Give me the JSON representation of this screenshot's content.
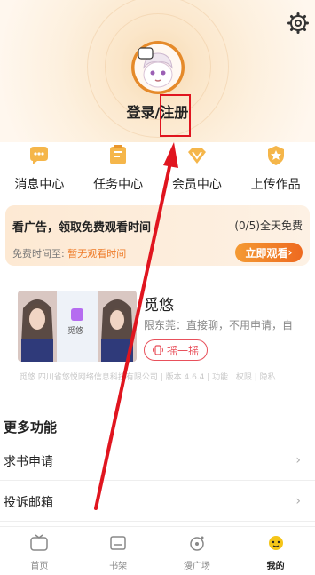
{
  "header": {
    "login_text": "登录/注册"
  },
  "quick_actions": [
    {
      "label": "消息中心",
      "icon": "message-icon"
    },
    {
      "label": "任务中心",
      "icon": "task-icon"
    },
    {
      "label": "会员中心",
      "icon": "vip-icon"
    },
    {
      "label": "上传作品",
      "icon": "upload-icon"
    }
  ],
  "ad_card": {
    "title": "看广告，领取免费观看时间",
    "count": "(0/5)全天免费",
    "free_time_label": "免费时间至:",
    "free_time_value": "暂无观看时间",
    "button_label": "立即观看",
    "button_arrow": "›"
  },
  "promo": {
    "title": "觅悠",
    "description": "限东莞：直接聊，不用申请，自",
    "shake_label": "摇一摇",
    "app_name": "觅悠",
    "footer_note": "觅悠 四川省悠悦网络信息科技有限公司 | 版本 4.6.4 | 功能 | 权限 | 隐私"
  },
  "more_functions": {
    "title": "更多功能",
    "items": [
      {
        "label": "求书申请",
        "chevron": "›"
      },
      {
        "label": "投诉邮箱",
        "chevron": "›"
      }
    ]
  },
  "tabbar": [
    {
      "label": "首页",
      "icon": "home-tv-icon",
      "active": false
    },
    {
      "label": "书架",
      "icon": "bookshelf-icon",
      "active": false
    },
    {
      "label": "漫广场",
      "icon": "comic-square-icon",
      "active": false
    },
    {
      "label": "我的",
      "icon": "mine-face-icon",
      "active": true
    }
  ],
  "colors": {
    "accent_orange": "#ee7a26",
    "annotation_red": "#e0151f",
    "shake_red": "#e8505b"
  }
}
